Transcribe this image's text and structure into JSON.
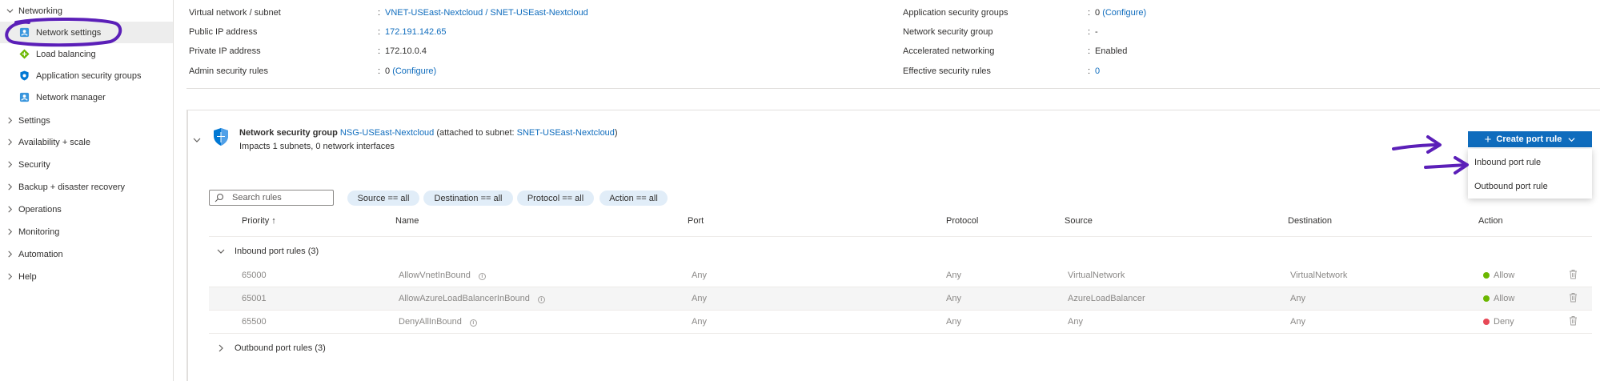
{
  "sidebar": {
    "networking_label": "Networking",
    "sub_items": [
      {
        "label": "Network settings",
        "icon": "network-settings-icon"
      },
      {
        "label": "Load balancing",
        "icon": "load-balancing-icon"
      },
      {
        "label": "Application security groups",
        "icon": "asg-shield-icon"
      },
      {
        "label": "Network manager",
        "icon": "network-manager-icon"
      }
    ],
    "items": [
      {
        "label": "Settings"
      },
      {
        "label": "Availability + scale"
      },
      {
        "label": "Security"
      },
      {
        "label": "Backup + disaster recovery"
      },
      {
        "label": "Operations"
      },
      {
        "label": "Monitoring"
      },
      {
        "label": "Automation"
      },
      {
        "label": "Help"
      }
    ]
  },
  "properties": {
    "left": [
      {
        "key": "Virtual network / subnet",
        "value": "VNET-USEast-Nextcloud / SNET-USEast-Nextcloud",
        "link": true
      },
      {
        "key": "Public IP address",
        "value": "172.191.142.65",
        "link": true
      },
      {
        "key": "Private IP address",
        "value": "172.10.0.4",
        "link": false
      },
      {
        "key": "Admin security rules",
        "value_prefix": "0",
        "value_link": "(Configure)"
      }
    ],
    "right": [
      {
        "key": "Application security groups",
        "value_prefix": "0",
        "value_link": "(Configure)"
      },
      {
        "key": "Network security group",
        "value": "-",
        "link": false
      },
      {
        "key": "Accelerated networking",
        "value": "Enabled",
        "link": false
      },
      {
        "key": "Effective security rules",
        "value": "0",
        "link": true
      }
    ],
    "separator": ":"
  },
  "nsg": {
    "title_prefix": "Network security group",
    "name": "NSG-USEast-Nextcloud",
    "attached_prefix": "(attached to subnet:",
    "subnet": "SNET-USEast-Nextcloud",
    "attached_suffix": ")",
    "impact": "Impacts 1 subnets, 0 network interfaces"
  },
  "create_menu": {
    "button_label": "Create port rule",
    "items": [
      "Inbound port rule",
      "Outbound port rule"
    ]
  },
  "filters": {
    "search_placeholder": "Search rules",
    "pills": [
      "Source == all",
      "Destination == all",
      "Protocol == all",
      "Action == all"
    ]
  },
  "table": {
    "columns": [
      "Priority ↑",
      "Name",
      "Port",
      "Protocol",
      "Source",
      "Destination",
      "Action"
    ],
    "groups": [
      {
        "label": "Inbound port rules (3)",
        "expanded": true
      },
      {
        "label": "Outbound port rules (3)",
        "expanded": false
      }
    ],
    "rows": [
      {
        "priority": "65000",
        "name": "AllowVnetInBound",
        "port": "Any",
        "protocol": "Any",
        "source": "VirtualNetwork",
        "destination": "VirtualNetwork",
        "action": "Allow"
      },
      {
        "priority": "65001",
        "name": "AllowAzureLoadBalancerInBound",
        "port": "Any",
        "protocol": "Any",
        "source": "AzureLoadBalancer",
        "destination": "Any",
        "action": "Allow"
      },
      {
        "priority": "65500",
        "name": "DenyAllInBound",
        "port": "Any",
        "protocol": "Any",
        "source": "Any",
        "destination": "Any",
        "action": "Deny"
      }
    ]
  },
  "colors": {
    "accent": "#0f6cbd",
    "annotation": "#5b1fb8",
    "allow": "#6bb700",
    "deny": "#e74856",
    "pill_bg": "#e1edf8"
  }
}
